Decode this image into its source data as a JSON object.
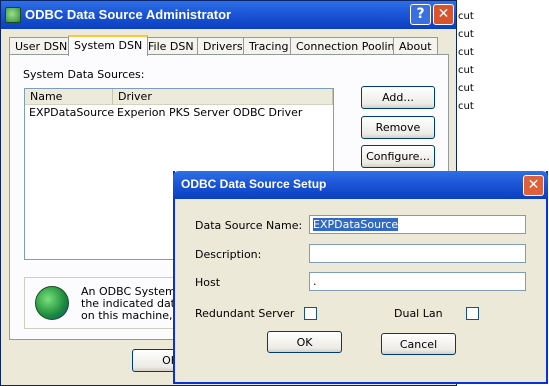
{
  "background": {
    "items": [
      "cut",
      "cut",
      "cut",
      "cut",
      "cut",
      "cut"
    ]
  },
  "admin": {
    "title": "ODBC Data Source Administrator",
    "help_glyph": "?",
    "close_glyph": "✕",
    "tabs": [
      "User DSN",
      "System DSN",
      "File DSN",
      "Drivers",
      "Tracing",
      "Connection Pooling",
      "About"
    ],
    "active_tab": "System DSN",
    "section_label": "System Data Sources:",
    "columns": [
      "Name",
      "Driver"
    ],
    "rows": [
      {
        "name": "EXPDataSource",
        "driver": "Experion PKS Server ODBC Driver"
      }
    ],
    "buttons": {
      "add": "Add...",
      "remove": "Remove",
      "configure": "Configure...",
      "ok": "OK"
    },
    "info_lines": [
      "An ODBC System da",
      "the indicated data p",
      "on this machine, inc"
    ]
  },
  "setup": {
    "title": "ODBC Data Source Setup",
    "close_glyph": "✕",
    "labels": {
      "dsn": "Data Source Name:",
      "description": "Description:",
      "host": "Host",
      "redundant": "Redundant Server",
      "dual_lan": "Dual Lan"
    },
    "values": {
      "dsn": "EXPDataSource",
      "description": "",
      "host": "."
    },
    "redundant_checked": false,
    "dual_lan_checked": false,
    "buttons": {
      "ok": "OK",
      "cancel": "Cancel"
    }
  },
  "colors": {
    "titlebar": "#0a3fc0",
    "dialog_bg": "#ece9d8",
    "selection": "#316ac5"
  }
}
